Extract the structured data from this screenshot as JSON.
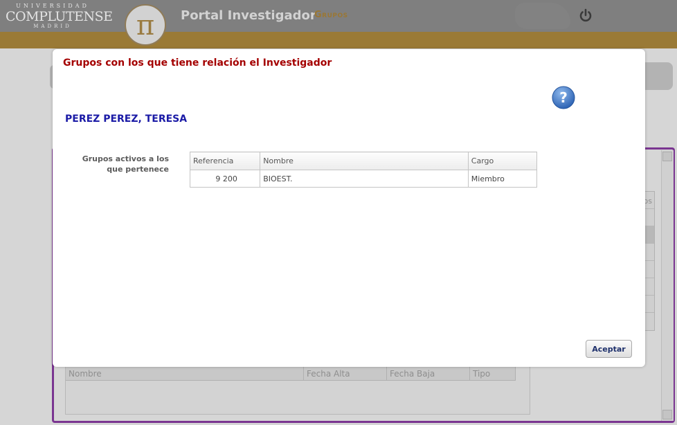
{
  "header": {
    "logo": {
      "line1": "UNIVERSIDAD",
      "line2": "COMPLUTENSE",
      "line3": "MADRID"
    },
    "pi_symbol": "π",
    "portal_title": "Portal Investigador",
    "nav_link": "Grupos",
    "power_icon": "power-icon"
  },
  "background": {
    "right_table_fragment": "os",
    "bottom_table_columns": [
      "Nombre",
      "Fecha Alta",
      "Fecha Baja",
      "Tipo"
    ]
  },
  "modal": {
    "title": "Grupos con los que tiene relación el Investigador",
    "help_icon": "help-question-icon",
    "researcher_name": "PEREZ PEREZ, TERESA",
    "groups_label": "Grupos activos a los que pertenece",
    "table": {
      "columns": [
        "Referencia",
        "Nombre",
        "Cargo"
      ],
      "rows": [
        {
          "referencia": "9  200",
          "nombre": "BIOEST.",
          "cargo": "Miembro"
        }
      ]
    },
    "accept_button": "Aceptar"
  },
  "colors": {
    "header_bg": "#7f7f7f",
    "gold_bar": "#9a7a36",
    "modal_title": "#a40000",
    "researcher_name": "#1a1aa6",
    "frame_purple": "#7a3591"
  }
}
